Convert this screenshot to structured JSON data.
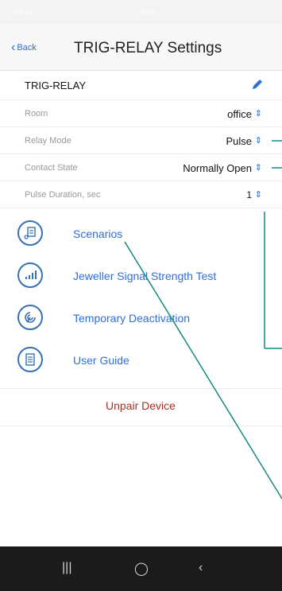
{
  "status": {
    "time": "15:18",
    "system": "59%"
  },
  "header": {
    "back_label": "Back",
    "title": "TRIG-RELAY Settings"
  },
  "device": {
    "name": "TRIG-RELAY"
  },
  "settings": [
    {
      "label": "Room",
      "value": "office"
    },
    {
      "label": "Relay Mode",
      "value": "Pulse"
    },
    {
      "label": "Contact State",
      "value": "Normally Open"
    },
    {
      "label": "Pulse Duration, sec",
      "value": "1"
    }
  ],
  "menu": [
    {
      "label": "Scenarios",
      "icon": "scenarios-icon"
    },
    {
      "label": "Jeweller Signal Strength Test",
      "icon": "signal-strength-icon"
    },
    {
      "label": "Temporary Deactivation",
      "icon": "deactivation-icon"
    },
    {
      "label": "User Guide",
      "icon": "user-guide-icon"
    }
  ],
  "unpair_label": "Unpair Device",
  "colors": {
    "accent": "#2f6fd6",
    "danger": "#a5312a",
    "annotation": "#138a82"
  }
}
